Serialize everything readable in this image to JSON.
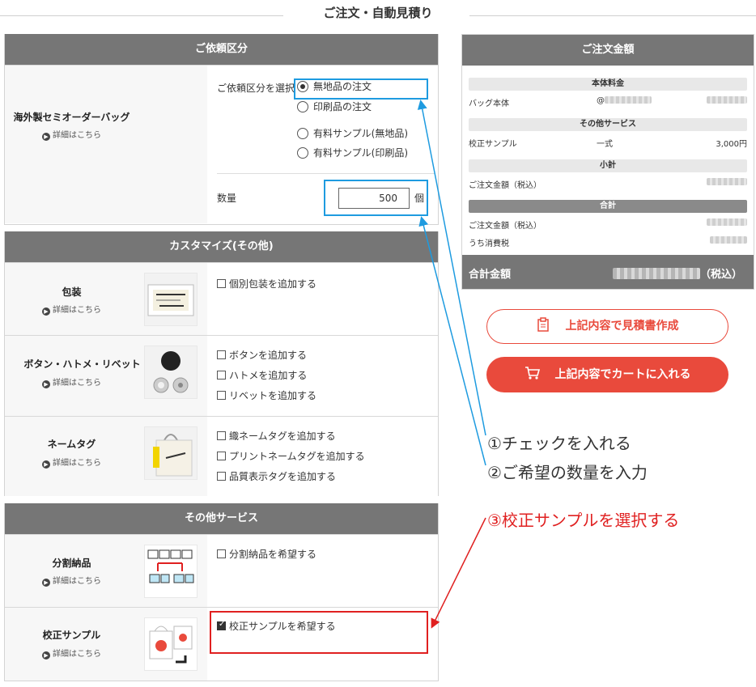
{
  "page": {
    "title": "ご注文・自動見積り"
  },
  "links": {
    "details": "詳細はこちら"
  },
  "request_section": {
    "header": "ご依頼区分",
    "product_name": "海外製セミオーダーバッグ",
    "select_label": "ご依頼区分を選択",
    "options": [
      "無地品の注文",
      "印刷品の注文",
      "有料サンプル(無地品)",
      "有料サンプル(印刷品)"
    ],
    "selected_index": 0,
    "qty_label": "数量",
    "qty_value": "500",
    "qty_unit": "個"
  },
  "customize_section": {
    "header": "カスタマイズ(その他)",
    "items": [
      {
        "name": "包装",
        "image": "packaging-image",
        "checkboxes": [
          "個別包装を追加する"
        ]
      },
      {
        "name": "ボタン・ハトメ・リベット",
        "image": "button-image",
        "checkboxes": [
          "ボタンを追加する",
          "ハトメを追加する",
          "リベットを追加する"
        ]
      },
      {
        "name": "ネームタグ",
        "image": "name-tag-image",
        "checkboxes": [
          "織ネームタグを追加する",
          "プリントネームタグを追加する",
          "品質表示タグを追加する"
        ]
      }
    ]
  },
  "service_section": {
    "header": "その他サービス",
    "items": [
      {
        "name": "分割納品",
        "image": "split-delivery-image",
        "checkboxes": [
          "分割納品を希望する"
        ],
        "checked": false
      },
      {
        "name": "校正サンプル",
        "image": "proof-sample-image",
        "checkboxes": [
          "校正サンプルを希望する"
        ],
        "checked": true
      }
    ]
  },
  "summary": {
    "header": "ご注文金額",
    "base_title": "本体料金",
    "bag_label": "バッグ本体",
    "bag_qty_prefix": "@",
    "other_title": "その他サービス",
    "proof_label": "校正サンプル",
    "proof_unit": "一式",
    "proof_price": "3,000円",
    "subtotal_title": "小計",
    "subtotal_label": "ご注文金額（税込）",
    "total_title": "合計",
    "total_label": "ご注文金額（税込）",
    "tax_label": "うち消費税",
    "grand_label": "合計金額",
    "grand_suffix": "（税込）"
  },
  "buttons": {
    "estimate": "上記内容で見積書作成",
    "cart": "上記内容でカートに入れる"
  },
  "annotations": {
    "step1": "①チェックを入れる",
    "step2": "②ご希望の数量を入力",
    "step3": "③校正サンプルを選択する"
  },
  "colors": {
    "header_gray": "#767676",
    "accent_red": "#e94a3c",
    "highlight_blue": "#1e9be0",
    "highlight_red": "#e02020"
  }
}
